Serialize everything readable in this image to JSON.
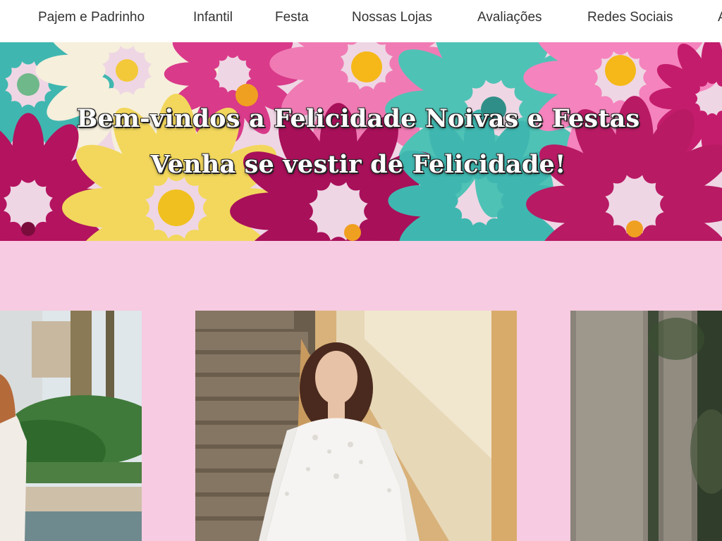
{
  "nav": {
    "items": [
      {
        "label": "Pajem e Padrinho"
      },
      {
        "label": "Infantil"
      },
      {
        "label": "Festa"
      },
      {
        "label": "Nossas Lojas"
      },
      {
        "label": "Avaliações"
      },
      {
        "label": "Redes Sociais"
      },
      {
        "label": "A"
      }
    ]
  },
  "hero": {
    "line1": "Bem-vindos a Felicidade Noivas e Festas",
    "line2": "Venha se vestir de Felicidade!"
  },
  "colors": {
    "page_background": "#f7cbe1",
    "nav_background": "#ffffff",
    "nav_text": "#333333",
    "flower_pink": "#ea4f9a",
    "flower_teal": "#3fb7b0",
    "flower_yellow": "#f2d75c",
    "flower_magenta": "#b3135f",
    "flower_cream": "#f6efdc"
  }
}
